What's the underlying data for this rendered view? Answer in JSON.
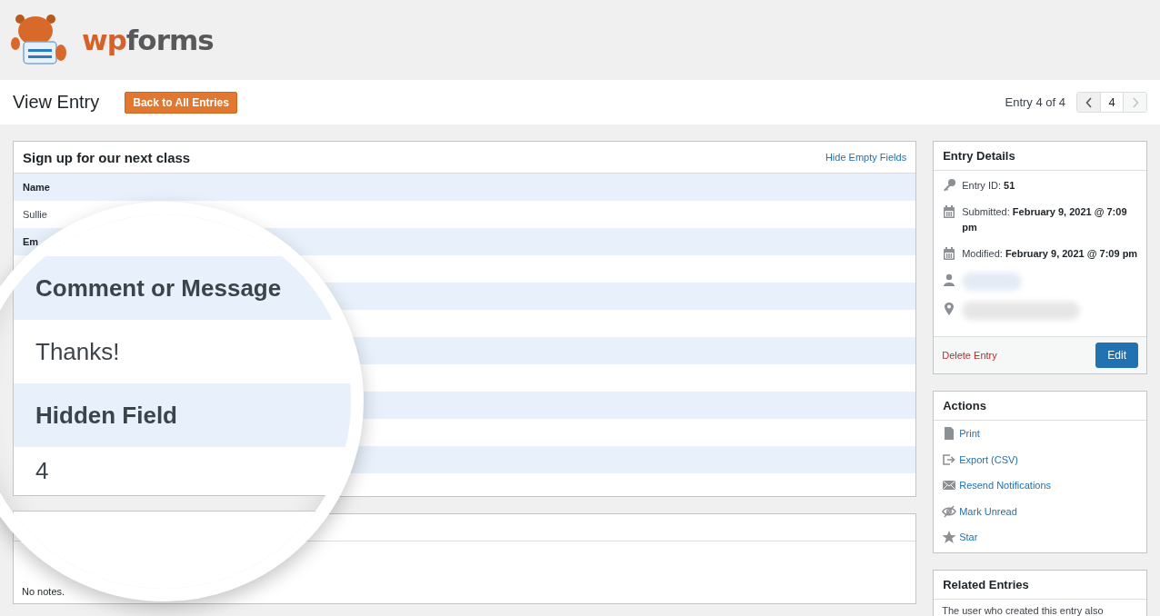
{
  "logo": {
    "accent": "wp",
    "rest": "forms"
  },
  "header": {
    "title": "View Entry",
    "back_button": "Back to All Entries"
  },
  "pager": {
    "label": "Entry 4 of 4",
    "current": "4",
    "prev_disabled": false,
    "next_disabled": true
  },
  "entry_panel": {
    "title": "Sign up for our next class",
    "hide_link": "Hide Empty Fields",
    "rows": [
      {
        "label": "Name",
        "value": "Sullie"
      },
      {
        "label": "Em"
      }
    ]
  },
  "notes_panel": {
    "text": "No notes."
  },
  "magnifier": {
    "rows": [
      {
        "label": "Comment or Message",
        "value": "Thanks!"
      },
      {
        "label": "Hidden Field",
        "value": "4"
      }
    ]
  },
  "entry_details": {
    "title": "Entry Details",
    "items": [
      {
        "kind": "id",
        "text": "Entry ID: **51**"
      },
      {
        "kind": "date",
        "text": "Submitted: **February 9, 2021 @ 7:09 pm**"
      },
      {
        "kind": "date",
        "text": "Modified: **February 9, 2021 @ 7:09 pm**"
      },
      {
        "kind": "user"
      },
      {
        "kind": "location"
      }
    ],
    "delete": "Delete Entry",
    "edit": "Edit"
  },
  "actions": {
    "title": "Actions",
    "items": [
      {
        "kind": "print",
        "label": "Print"
      },
      {
        "kind": "export",
        "label": "Export (CSV)"
      },
      {
        "kind": "resend",
        "label": "Resend Notifications"
      },
      {
        "kind": "unread",
        "label": "Mark Unread"
      },
      {
        "kind": "star",
        "label": "Star"
      }
    ]
  },
  "related": {
    "title": "Related Entries",
    "text": "The user who created this entry also"
  }
}
